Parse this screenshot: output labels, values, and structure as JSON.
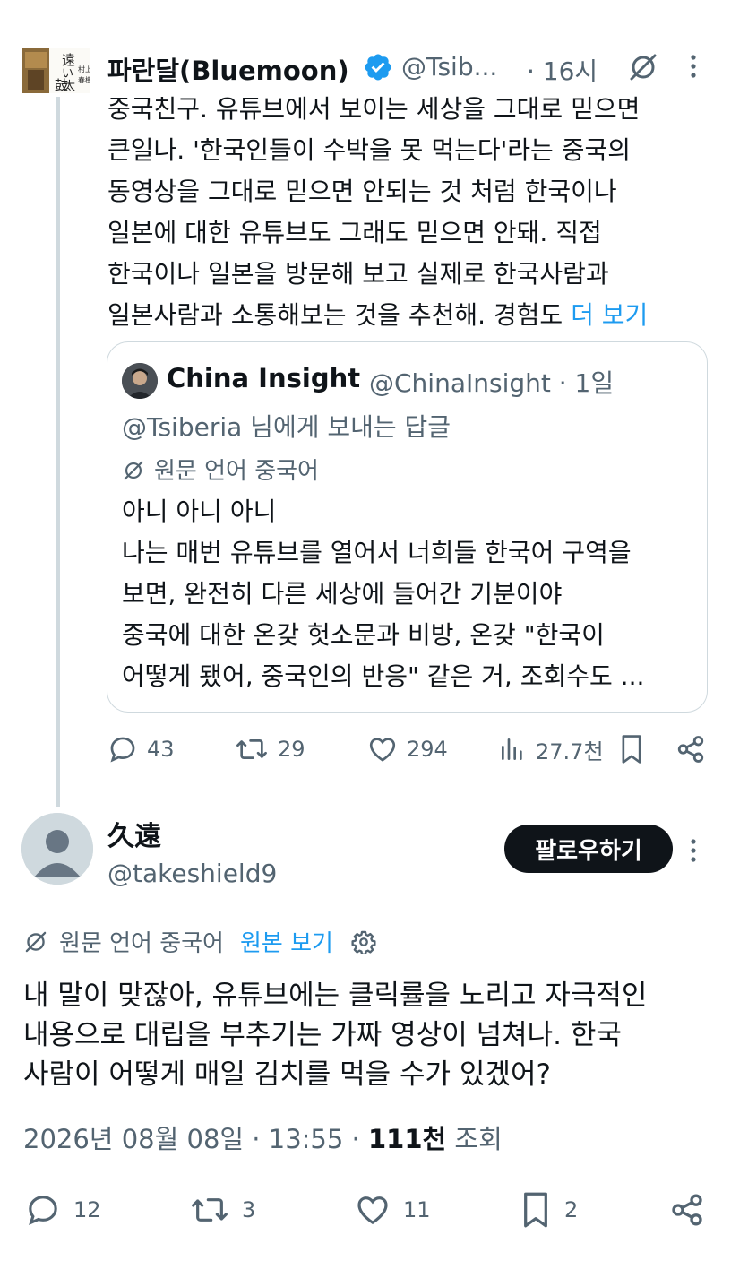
{
  "tweet": {
    "author_name": "파란달(Bluemoon)",
    "handle": "@Tsib...",
    "time": "· 16시",
    "avatar_text": {
      "big": "遠い太鼓",
      "small": "村上春樹"
    },
    "body_lines": [
      "중국친구. 유튜브에서 보이는 세상을 그대로 믿으면",
      "큰일나. '한국인들이 수박을 못 먹는다'라는 중국의",
      "동영상을 그대로 믿으면 안되는 것 처럼 한국이나",
      "일본에 대한 유튜브도 그래도 믿으면 안돼. 직접",
      "한국이나 일본을 방문해 보고 실제로 한국사람과",
      "일본사람과 소통해보는 것을 추천해. 경험도"
    ],
    "more_label": "더 보기",
    "quote": {
      "name": "China Insight",
      "handle": "@ChinaInsight · 1일",
      "reply_to": "@Tsiberia 님에게 보내는 답글",
      "language_note": "원문 언어 중국어",
      "body_lines": [
        "아니 아니 아니",
        "나는 매번 유튜브를 열어서 너희들 한국어 구역을",
        "보면, 완전히 다른 세상에 들어간 기분이야",
        "중국에 대한 온갖 헛소문과 비방, 온갖 \"한국이",
        "어떻게 됐어, 중국인의 반응\" 같은 거, 조회수도 ..."
      ]
    },
    "stats": {
      "replies": "43",
      "retweets": "29",
      "likes": "294",
      "views": "27.7천"
    }
  },
  "reply": {
    "author_name": "久遠",
    "handle": "@takeshield9",
    "follow_label": "팔로우하기",
    "language_note": "원문 언어 중국어",
    "original_link": "원본 보기",
    "body_lines": [
      "내 말이 맞잖아, 유튜브에는 클릭률을 노리고 자극적인",
      "내용으로 대립을 부추기는 가짜 영상이 넘쳐나. 한국",
      "사람이 어떻게 매일 김치를 먹을 수가 있겠어?"
    ],
    "date": "2026년 08월 08일 · 13:55 ·",
    "views_count": "111천",
    "views_label": "조회",
    "stats": {
      "replies": "12",
      "retweets": "3",
      "likes": "11",
      "bookmarks": "2"
    }
  },
  "colors": {
    "accent": "#1d9bf0",
    "muted": "#536471",
    "text": "#0f1419",
    "border": "#cfd9de"
  }
}
